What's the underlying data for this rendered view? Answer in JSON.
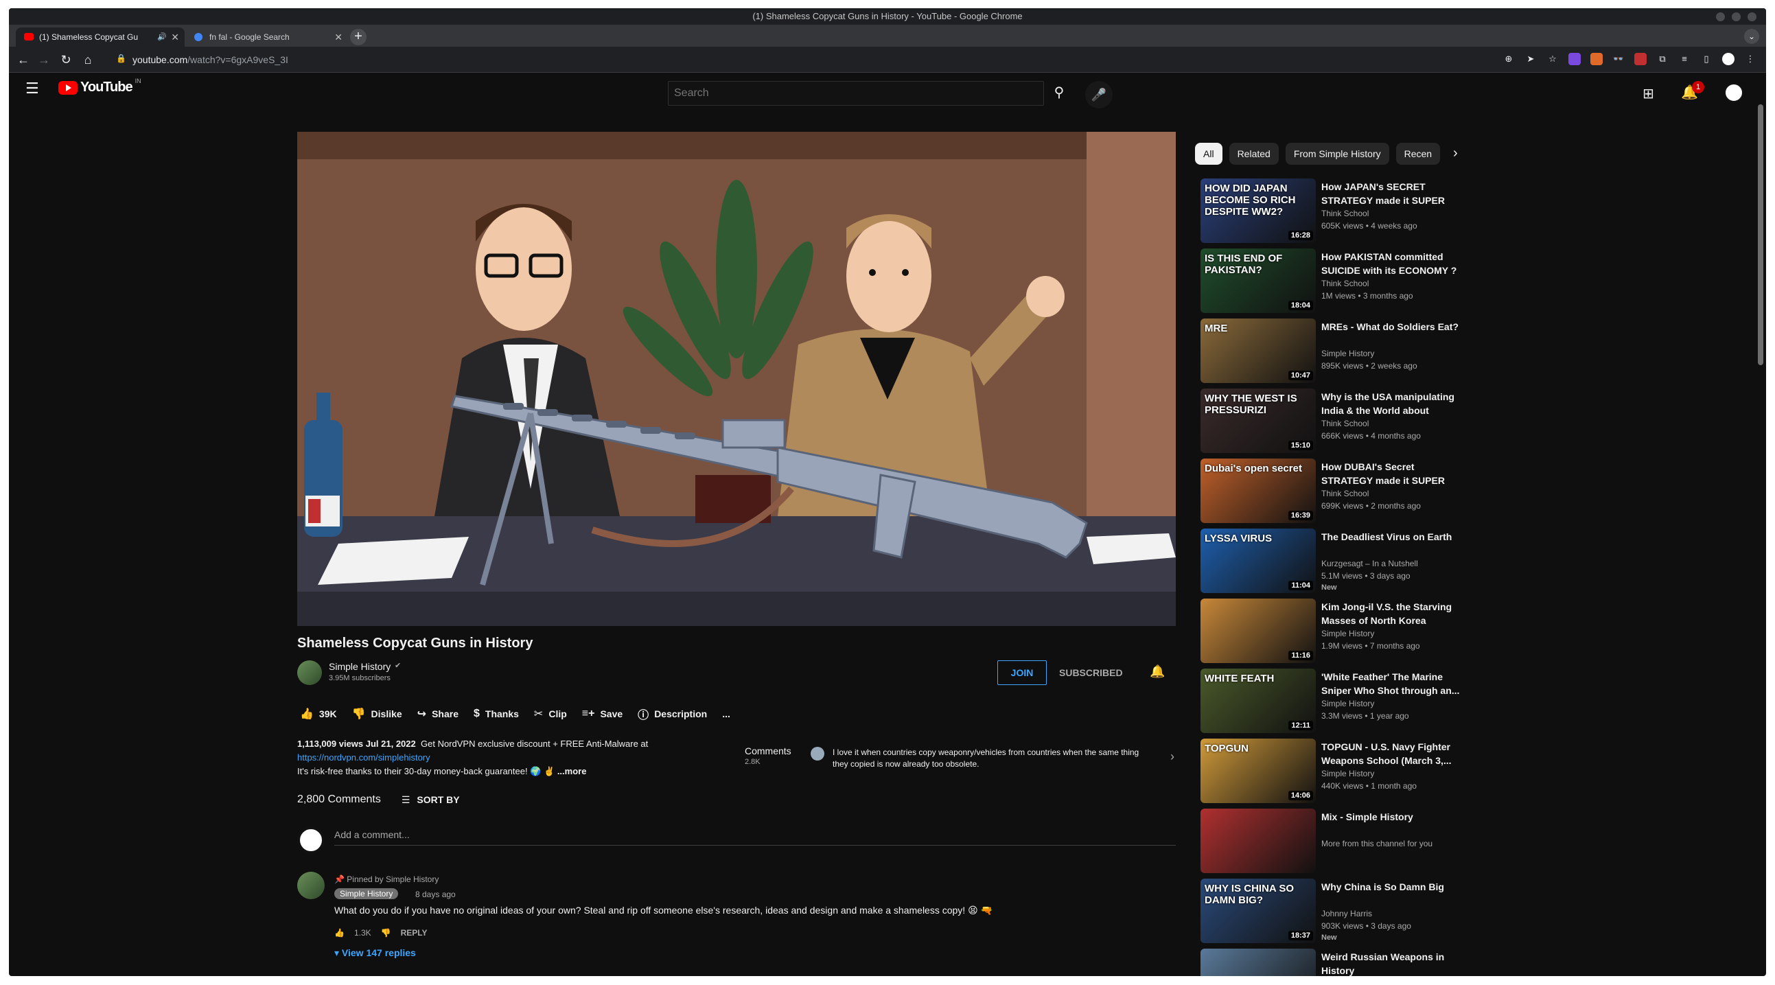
{
  "window_title": "(1) Shameless Copycat Guns in History - YouTube - Google Chrome",
  "tabs": [
    {
      "label": "(1) Shameless Copycat Gu",
      "favicon_color": "#ff0000",
      "active": true
    },
    {
      "label": "fn fal - Google Search",
      "favicon_color": "#4285f4",
      "active": false
    }
  ],
  "address": {
    "host": "youtube.com",
    "path": "/watch?v=6gxA9veS_3I"
  },
  "youtube": {
    "logo_text": "YouTube",
    "country": "IN",
    "search_placeholder": "Search",
    "notification_count": "1"
  },
  "video": {
    "title": "Shameless Copycat Guns in History",
    "channel": "Simple History",
    "subscribers": "3.95M subscribers",
    "join": "JOIN",
    "subscribed": "SUBSCRIBED",
    "actions": {
      "likes": "39K",
      "dislike": "Dislike",
      "share": "Share",
      "thanks": "Thanks",
      "clip": "Clip",
      "save": "Save",
      "description": "Description",
      "more": "..."
    },
    "description": {
      "stats": "1,113,009 views  Jul 21, 2022",
      "text": "Get NordVPN exclusive discount + FREE Anti-Malware at",
      "link": "https://nordvpn.com/simplehistory",
      "text2": "It's risk-free thanks to their 30-day money-back guarantee! 🌍 ✌️",
      "more": "...more"
    }
  },
  "comments_teaser": {
    "label": "Comments",
    "count": "2.8K",
    "text": "I love it when countries copy weaponry/vehicles from countries when the same thing they copied is now already too obsolete."
  },
  "comments": {
    "count": "2,800 Comments",
    "sort": "SORT BY",
    "add_placeholder": "Add a comment...",
    "pinned": {
      "label": "Pinned by Simple History",
      "author": "Simple History",
      "time": "8 days ago",
      "text": "What do you do if you have no original ideas of your own? Steal and rip off someone else's research, ideas and design and make a shameless copy! 😫 🔫",
      "likes": "1.3K",
      "reply": "REPLY",
      "view_replies": "View 147 replies"
    }
  },
  "chips": [
    "All",
    "Related",
    "From Simple History",
    "Recen"
  ],
  "recommendations": [
    {
      "title": "How JAPAN's SECRET STRATEGY made it SUPER RIC...",
      "channel": "Think School",
      "meta": "605K views • 4 weeks ago",
      "duration": "16:28",
      "thumb_text": "HOW DID JAPAN BECOME SO RICH DESPITE WW2?",
      "color": "#2a3f7a"
    },
    {
      "title": "How PAKISTAN committed SUICIDE with its ECONOMY ? :...",
      "channel": "Think School",
      "meta": "1M views • 3 months ago",
      "duration": "18:04",
      "thumb_text": "IS THIS END OF PAKISTAN?",
      "color": "#1f4d2b"
    },
    {
      "title": "MREs - What do Soldiers Eat?",
      "channel": "Simple History",
      "meta": "895K views • 2 weeks ago",
      "duration": "10:47",
      "thumb_text": "MRE",
      "color": "#8a6a3a"
    },
    {
      "title": "Why is the USA manipulating India & the World about Russia...",
      "channel": "Think School",
      "meta": "666K views • 4 months ago",
      "duration": "15:10",
      "thumb_text": "WHY THE WEST IS PRESSURIZI",
      "color": "#3a2a2a"
    },
    {
      "title": "How DUBAI's Secret STRATEGY made it SUPER RICH & SUPER...",
      "channel": "Think School",
      "meta": "699K views • 2 months ago",
      "duration": "16:39",
      "thumb_text": "Dubai's open secret",
      "color": "#c0602a"
    },
    {
      "title": "The Deadliest Virus on Earth",
      "channel": "Kurzgesagt – In a Nutshell",
      "meta": "5.1M views • 3 days ago",
      "duration": "11:04",
      "thumb_text": "LYSSA VIRUS",
      "color": "#1e5fae",
      "new": "New"
    },
    {
      "title": "Kim Jong-il V.S. the Starving Masses of North Korea",
      "channel": "Simple History",
      "meta": "1.9M views • 7 months ago",
      "duration": "11:16",
      "thumb_text": "",
      "color": "#c8883a"
    },
    {
      "title": "'White Feather' The Marine Sniper Who Shot through an...",
      "channel": "Simple History",
      "meta": "3.3M views • 1 year ago",
      "duration": "12:11",
      "thumb_text": "WHITE FEATH",
      "color": "#4a5a2a"
    },
    {
      "title": "TOPGUN - U.S. Navy Fighter Weapons School (March 3,...",
      "channel": "Simple History",
      "meta": "440K views • 1 month ago",
      "duration": "14:06",
      "thumb_text": "TOPGUN",
      "color": "#d09a3a"
    },
    {
      "title": "Mix - Simple History",
      "channel": "More from this channel for you",
      "meta": "",
      "duration": "",
      "thumb_text": "",
      "color": "#b03030"
    },
    {
      "title": "Why China is So Damn Big",
      "channel": "Johnny Harris",
      "meta": "903K views • 3 days ago",
      "duration": "18:37",
      "thumb_text": "WHY IS CHINA SO DAMN BIG?",
      "color": "#2a4a7a",
      "new": "New"
    },
    {
      "title": "Weird Russian Weapons in History",
      "channel": "",
      "meta": "",
      "duration": "",
      "thumb_text": "",
      "color": "#5a7a9a"
    }
  ]
}
